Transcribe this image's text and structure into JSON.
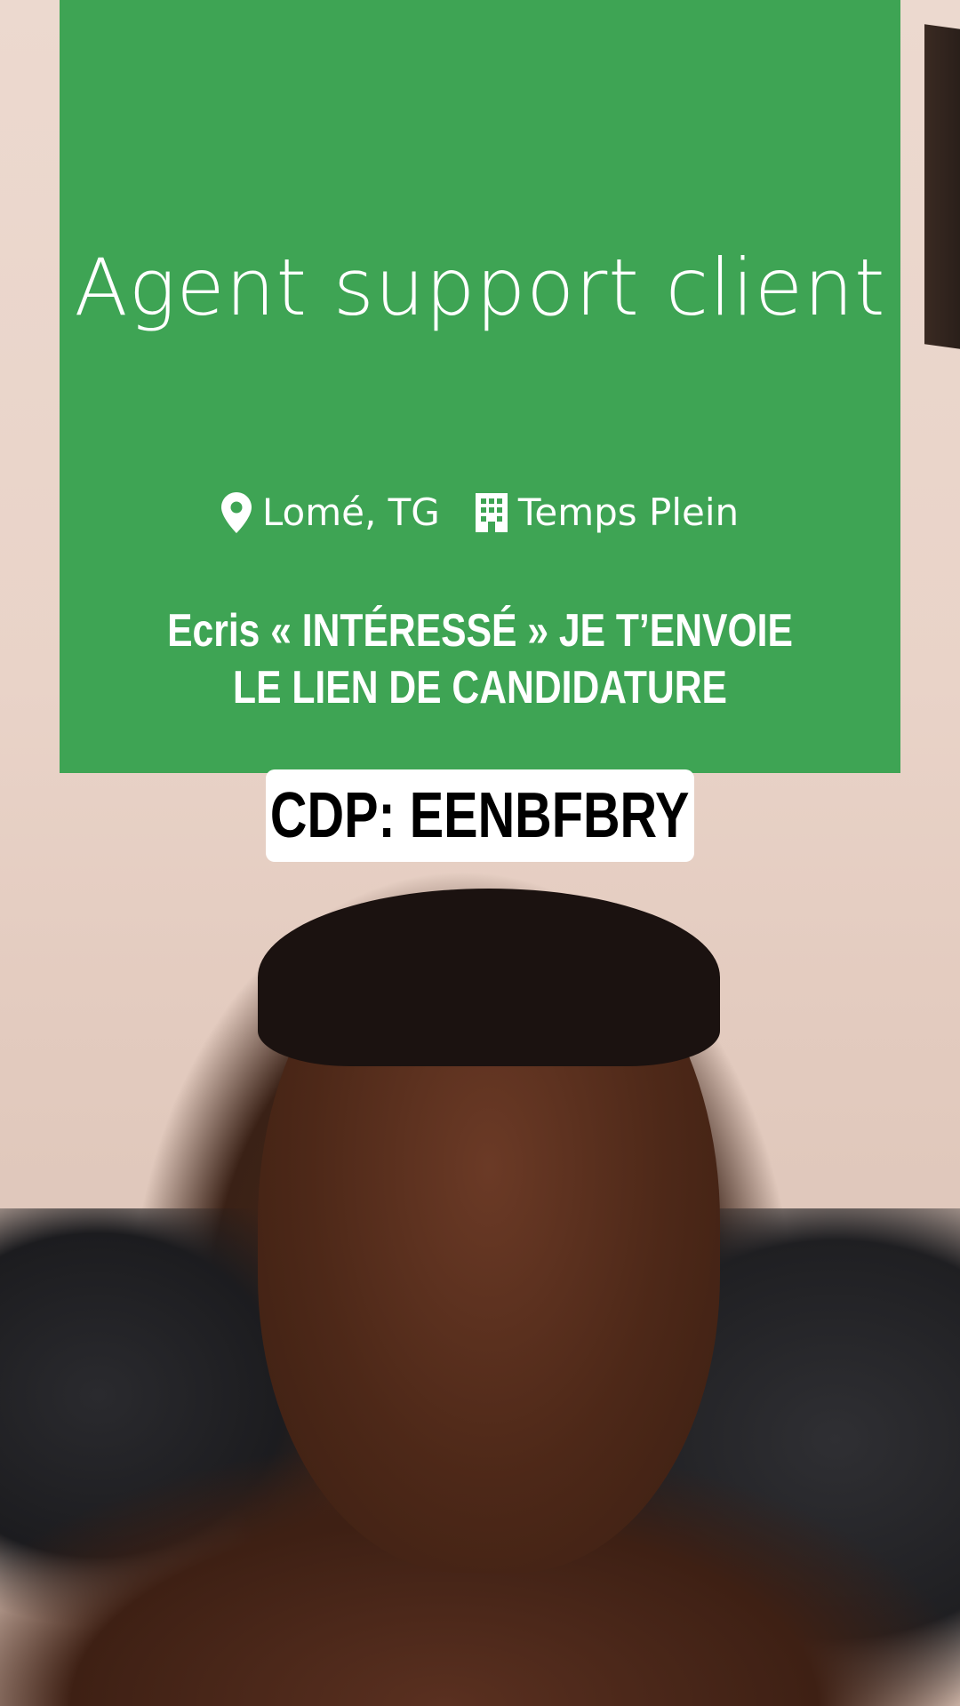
{
  "card": {
    "title": "Agent support client",
    "location": "Lomé, TG",
    "contract": "Temps Plein",
    "cta_line1": "Ecris « INTÉRESSÉ » JE T’ENVOIE",
    "cta_line2": "LE LIEN DE CANDIDATURE",
    "background_color": "#3ea454"
  },
  "badge": {
    "text": "CDP: EENBFBRY"
  },
  "icons": {
    "location": "map-pin-icon",
    "contract": "building-icon"
  }
}
